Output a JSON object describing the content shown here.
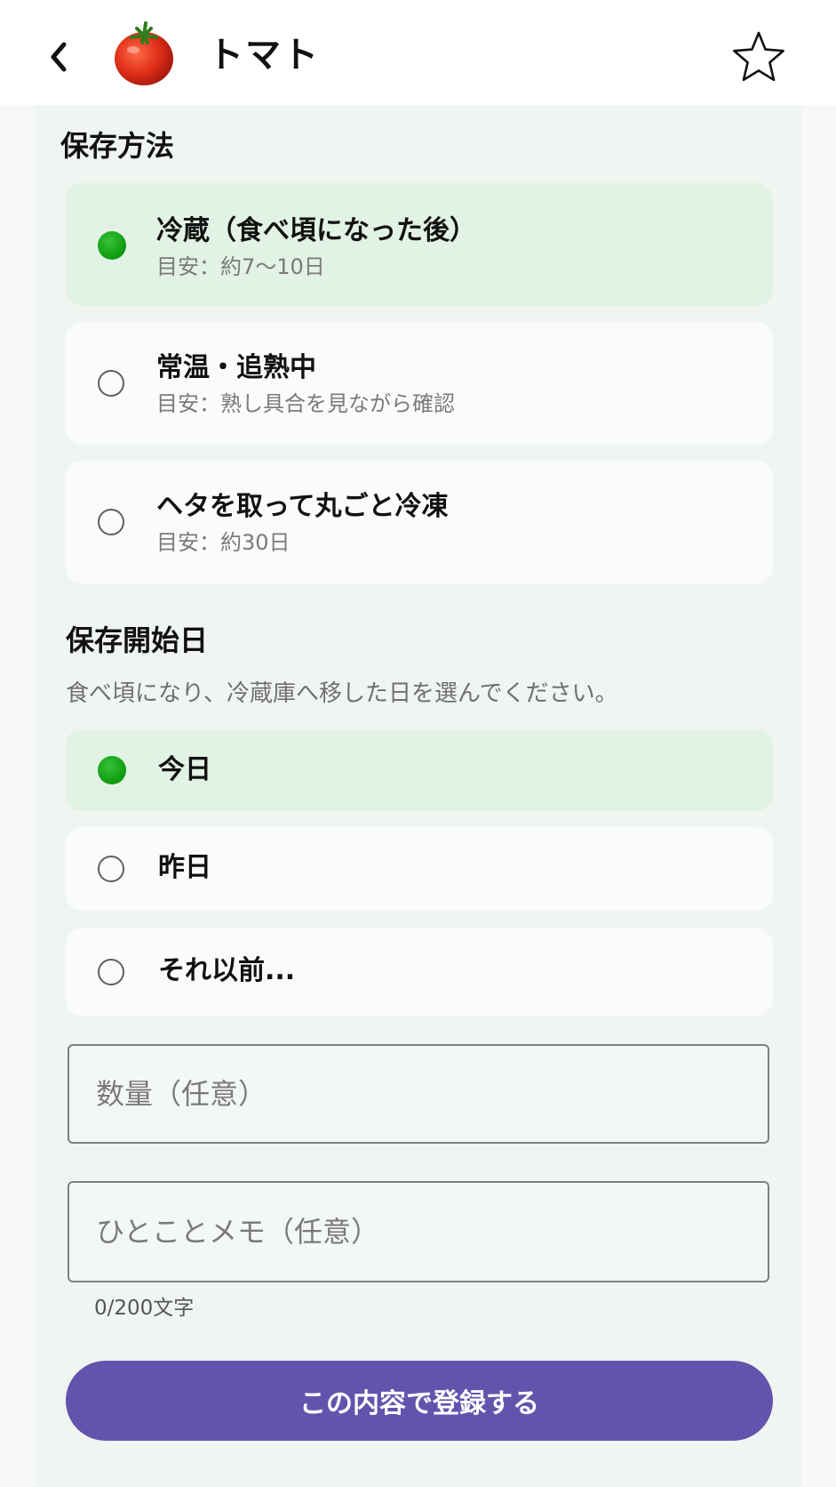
{
  "header": {
    "back_icon": "chevron-left-icon",
    "food_icon": "tomato-icon",
    "title": "トマト",
    "favorite_icon": "star-outline-icon"
  },
  "storage": {
    "title": "保存方法",
    "options": [
      {
        "label": "冷蔵（食べ頃になった後）",
        "note": "目安：約7〜10日",
        "selected": true
      },
      {
        "label": "常温・追熟中",
        "note": "目安：熟し具合を見ながら確認",
        "selected": false
      },
      {
        "label": "ヘタを取って丸ごと冷凍",
        "note": "目安：約30日",
        "selected": false
      }
    ]
  },
  "start_date": {
    "title": "保存開始日",
    "hint": "食べ頃になり、冷蔵庫へ移した日を選んでください。",
    "options": [
      {
        "label": "今日",
        "selected": true
      },
      {
        "label": "昨日",
        "selected": false
      },
      {
        "label": "それ以前...",
        "selected": false
      }
    ]
  },
  "form": {
    "quantity_placeholder": "数量（任意）",
    "quantity_value": "",
    "memo_placeholder": "ひとことメモ（任意）",
    "memo_value": "",
    "memo_counter": "0/200文字"
  },
  "submit_label": "この内容で登録する",
  "colors": {
    "accent": "#6453ad",
    "selected_bg": "#e2f2e4",
    "radio_on": "#12a012"
  }
}
